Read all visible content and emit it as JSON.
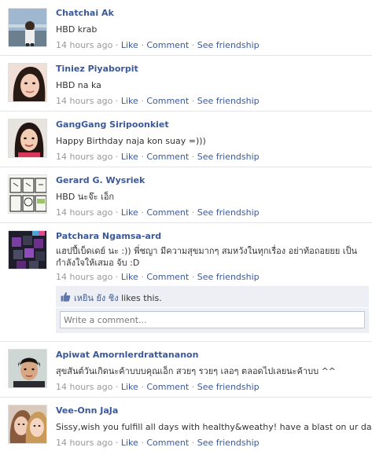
{
  "posts": [
    {
      "name": "Chatchai Ak",
      "message": "HBD krab",
      "time": "14 hours ago",
      "like": "Like",
      "comment": "Comment",
      "friendship": "See friendship",
      "sep": "·"
    },
    {
      "name": "Tiniez Piyaborpit",
      "message": "HBD na ka",
      "time": "14 hours ago",
      "like": "Like",
      "comment": "Comment",
      "friendship": "See friendship",
      "sep": "·"
    },
    {
      "name": "GangGang Siripoonkiet",
      "message": "Happy Birthday naja kon suay =)))",
      "time": "14 hours ago",
      "like": "Like",
      "comment": "Comment",
      "friendship": "See friendship",
      "sep": "·"
    },
    {
      "name": "Gerard G. Wysriek",
      "message": "HBD นะจ๊ะ เอ็ก",
      "time": "14 hours ago",
      "like": "Like",
      "comment": "Comment",
      "friendship": "See friendship",
      "sep": "·"
    },
    {
      "name": "Patchara Ngamsa-ard",
      "message": "แฮปปี้เบ็ดเดย์ นะ :)) พี่ชญา มีความสุขมากๆ สมหวังในทุกเรื่อง อย่าท้อถอยยย เป็นกำลังใจให้เสมอ จ้บ :D",
      "time": "14 hours ago",
      "like": "Like",
      "comment": "Comment",
      "friendship": "See friendship",
      "sep": "·"
    },
    {
      "name": "Apiwat Amornlerdrattananon",
      "message": "สุขสันต์วันเกิดนะค้าบบบคุณเอ็ก สวยๆ รวยๆ เลอๆ ตลอดไปเลยนะค้าบบ ^^",
      "time": "14 hours ago",
      "like": "Like",
      "comment": "Comment",
      "friendship": "See friendship",
      "sep": "·"
    },
    {
      "name": "Vee-Onn JaJa",
      "message": "Sissy,wish you fulfill all days with healthy&weathy! have a blast on ur day!",
      "time": "14 hours ago",
      "like": "Like",
      "comment": "Comment",
      "friendship": "See friendship",
      "sep": "·"
    }
  ],
  "likes_bar": {
    "who": "เหยิน ยัง ชิง",
    "text": "likes this.",
    "icon": "thumbs-up-icon"
  },
  "comment_box": {
    "placeholder": "Write a comment..."
  },
  "colors": {
    "link": "#3b5998",
    "meta": "#999999",
    "panel": "#edeff4"
  }
}
